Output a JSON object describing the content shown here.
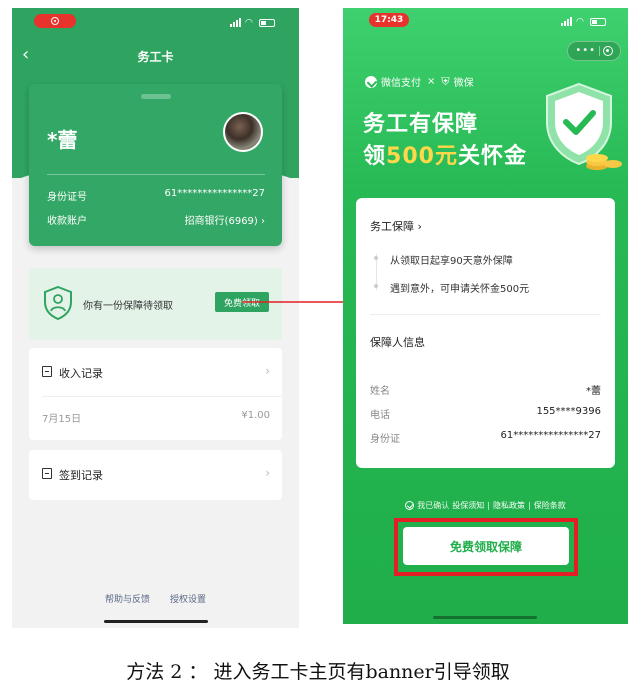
{
  "left_phone": {
    "nav_title": "务工卡",
    "card": {
      "name": "*蕾",
      "id_label": "身份证号",
      "id_value": "61***************27",
      "account_label": "收款账户",
      "account_value": "招商银行(6969) ›"
    },
    "banner": {
      "text": "你有一份保障待领取",
      "button_label": "免费领取"
    },
    "income": {
      "title": "收入记录",
      "date": "7月15日",
      "amount": "¥1.00"
    },
    "checkin": {
      "title": "签到记录"
    },
    "footer": {
      "help": "帮助与反馈",
      "auth": "授权设置"
    }
  },
  "right_phone": {
    "time": "17:43",
    "brand": {
      "wechat_pay": "微信支付",
      "separator": "×",
      "weibao": "微保"
    },
    "headline_1": "务工有保障",
    "headline_2_prefix": "领",
    "headline_2_amount": "500元",
    "headline_2_suffix": "关怀金",
    "card": {
      "title": "务工保障 ›",
      "item_1": "从领取日起享90天意外保障",
      "item_2": "遇到意外，可申请关怀金500元",
      "section": "保障人信息",
      "rows": [
        {
          "key": "姓名",
          "value": "*蕾"
        },
        {
          "key": "电话",
          "value": "155****9396"
        },
        {
          "key": "身份证",
          "value": "61***************27"
        }
      ]
    },
    "agree": {
      "prefix": "我已确认",
      "link_1": "投保须知",
      "link_2": "隐私政策",
      "link_3": "保险条款"
    },
    "claim_button": "免费领取保障"
  },
  "caption": "方法 2 ：  进入务工卡主页有banner引导领取",
  "colors": {
    "green": "#2fa460",
    "bright_green": "#27b954",
    "highlight_red": "#e31e24",
    "gold": "#ffd84a"
  }
}
